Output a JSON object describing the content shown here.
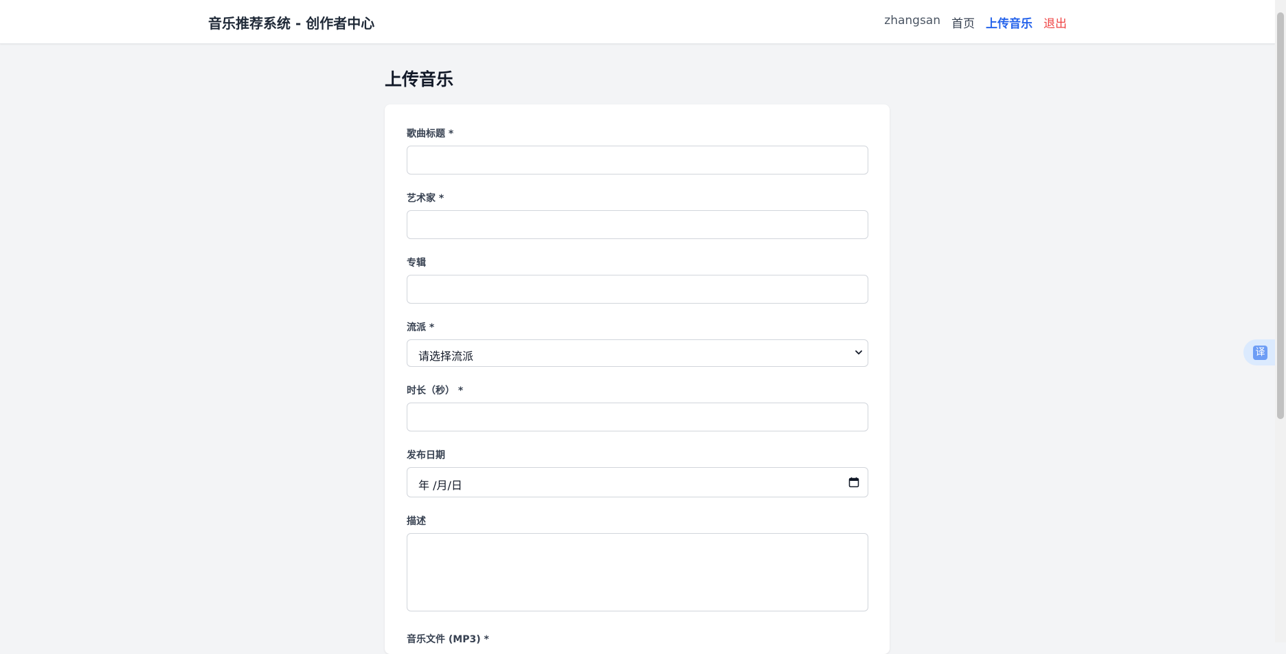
{
  "header": {
    "brand": "音乐推荐系统 - 创作者中心",
    "nav": {
      "username": "zhangsan",
      "home": "首页",
      "upload": "上传音乐",
      "logout": "退出"
    }
  },
  "page": {
    "title": "上传音乐"
  },
  "form": {
    "title_label": "歌曲标题 *",
    "title_value": "",
    "artist_label": "艺术家 *",
    "artist_value": "",
    "album_label": "专辑",
    "album_value": "",
    "genre_label": "流派 *",
    "genre_selected": "请选择流派",
    "duration_label": "时长（秒） *",
    "duration_value": "",
    "release_label": "发布日期",
    "release_value": "年 /月/日",
    "description_label": "描述",
    "description_value": "",
    "file_label": "音乐文件 (MP3) *"
  },
  "widgets": {
    "translate_glyph": "译"
  },
  "colors": {
    "accent": "#2563eb",
    "danger": "#ef4444",
    "background": "#f3f4f6"
  },
  "icons": [
    "chevron-down-icon",
    "calendar-icon",
    "resize-grip-icon",
    "translate-icon"
  ]
}
